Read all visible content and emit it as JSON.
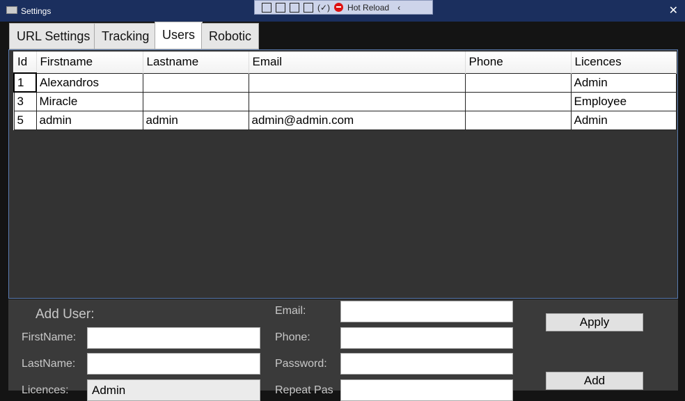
{
  "window": {
    "title": "Settings",
    "close": "✕"
  },
  "toolbar": {
    "hot_reload": "Hot Reload",
    "collapse": "‹"
  },
  "tabs": [
    {
      "label": "URL Settings"
    },
    {
      "label": "Tracking"
    },
    {
      "label": "Users"
    },
    {
      "label": "Robotic"
    }
  ],
  "grid": {
    "columns": [
      "Id",
      "Firstname",
      "Lastname",
      "Email",
      "Phone",
      "Licences"
    ],
    "rows": [
      [
        "1",
        "Alexandros",
        "",
        "",
        "",
        "Admin"
      ],
      [
        "3",
        "Miracle",
        "",
        "",
        "",
        "Employee"
      ],
      [
        "5",
        "admin",
        "admin",
        "admin@admin.com",
        "",
        "Admin"
      ]
    ]
  },
  "form": {
    "title": "Add User:",
    "firstname": "FirstName:",
    "lastname": "LastName:",
    "licences": "Licences:",
    "licences_value": "Admin",
    "email": "Email:",
    "phone": "Phone:",
    "password": "Password:",
    "repeat": "Repeat Pas",
    "apply": "Apply",
    "add": "Add"
  }
}
